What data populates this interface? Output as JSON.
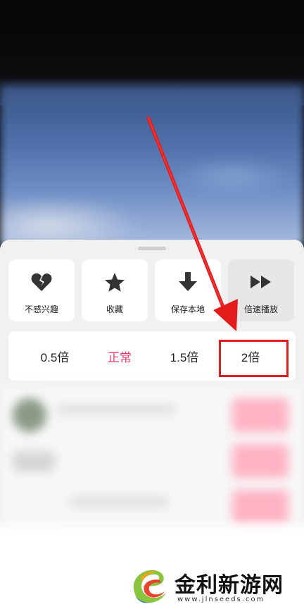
{
  "action_menu": {
    "items": [
      {
        "label": "不感兴趣",
        "icon": "broken-heart-icon"
      },
      {
        "label": "收藏",
        "icon": "star-icon"
      },
      {
        "label": "保存本地",
        "icon": "download-arrow-icon"
      },
      {
        "label": "倍速播放",
        "icon": "fast-forward-icon"
      }
    ]
  },
  "speed_options": {
    "items": [
      "0.5倍",
      "正常",
      "1.5倍",
      "2倍"
    ],
    "current": "正常"
  },
  "colors": {
    "accent": "#ff3366",
    "highlight": "#e21d1d",
    "arrow": "#e41b1b"
  },
  "watermark": {
    "name": "金利新游网",
    "url": "www.jlnseeds.com"
  }
}
